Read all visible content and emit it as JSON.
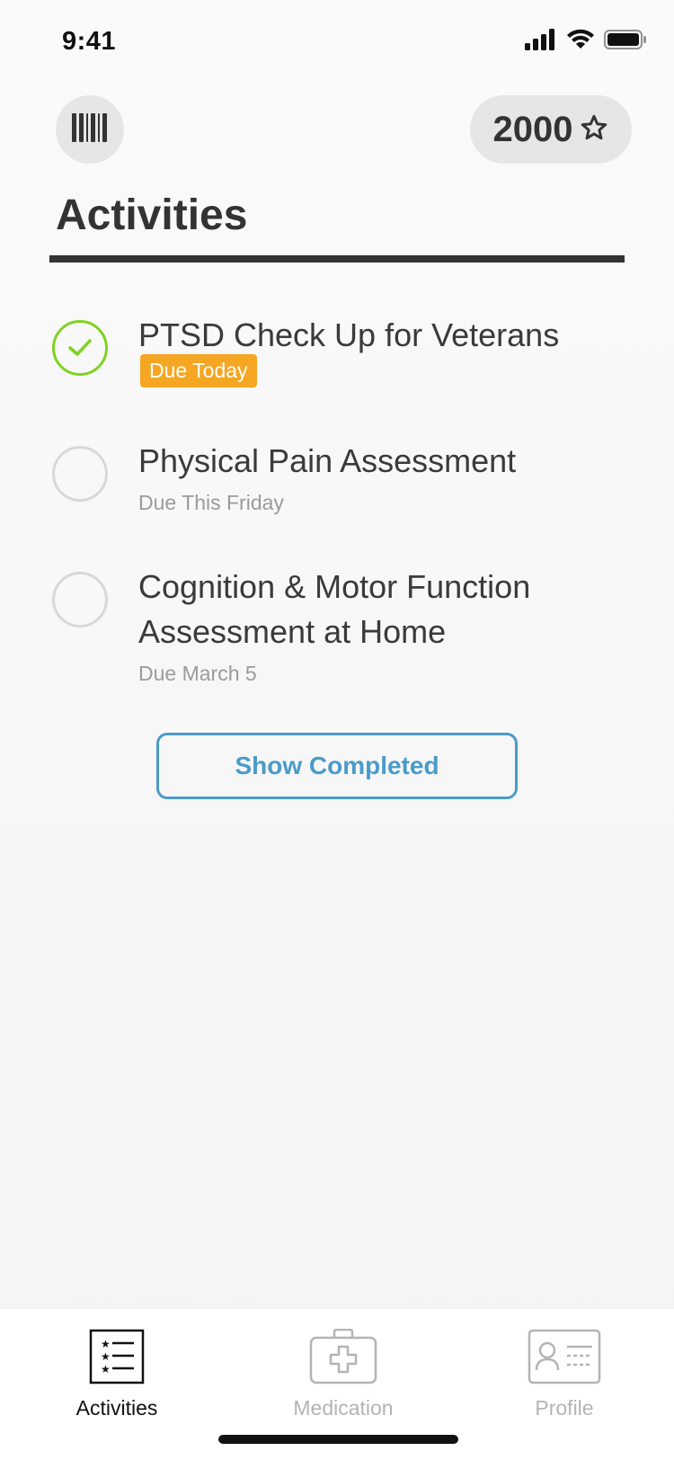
{
  "status_bar": {
    "time": "9:41"
  },
  "header": {
    "points": "2000"
  },
  "page": {
    "title": "Activities"
  },
  "activities": [
    {
      "title": "PTSD Check Up for Veterans",
      "due": "Due Today",
      "completed": true
    },
    {
      "title": "Physical Pain Assessment",
      "due": "Due This Friday",
      "completed": false
    },
    {
      "title": "Cognition & Motor Function Assessment at Home",
      "due": "Due March 5",
      "completed": false
    }
  ],
  "show_completed_label": "Show Completed",
  "tab_bar": {
    "tabs": [
      {
        "label": "Activities",
        "icon": "checklist-icon",
        "active": true
      },
      {
        "label": "Medication",
        "icon": "medical-kit-icon",
        "active": false
      },
      {
        "label": "Profile",
        "icon": "id-card-icon",
        "active": false
      }
    ]
  },
  "colors": {
    "accent_blue": "#4a9bc9",
    "complete_green": "#7ed321",
    "due_badge_orange": "#f5a623"
  }
}
